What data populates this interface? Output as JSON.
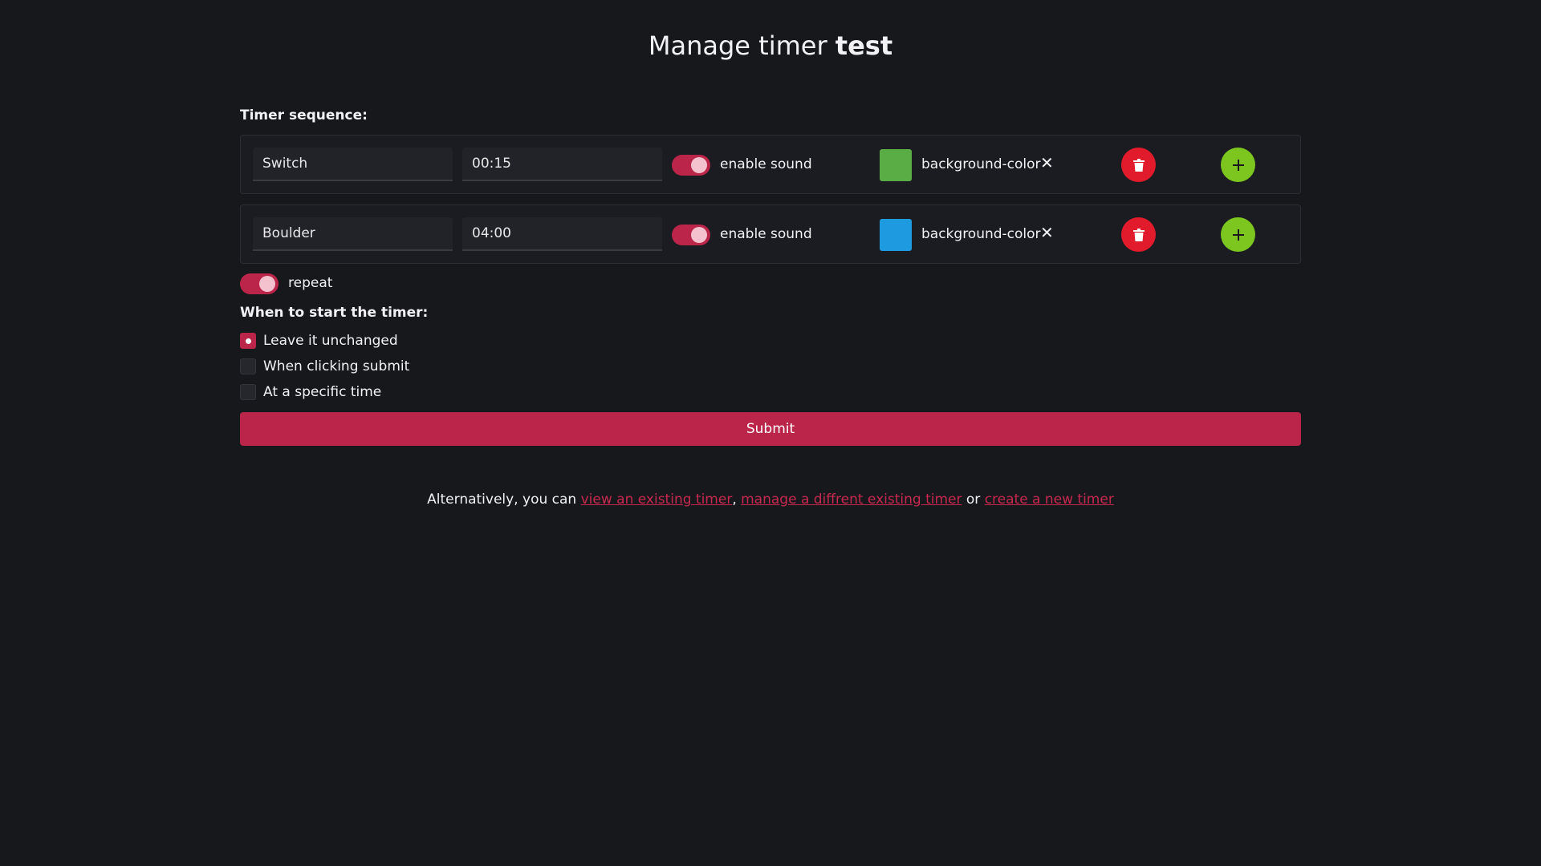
{
  "header": {
    "title_prefix": "Manage timer",
    "timer_name": "test"
  },
  "sequence": {
    "label": "Timer sequence:",
    "rows": [
      {
        "name": "Switch",
        "duration": "00:15",
        "sound_label": "enable sound",
        "sound_enabled": true,
        "color": "#5aac44",
        "color_label": "background-color",
        "clear_symbol": "✕"
      },
      {
        "name": "Boulder",
        "duration": "04:00",
        "sound_label": "enable sound",
        "sound_enabled": true,
        "color": "#1e9be0",
        "color_label": "background-color",
        "clear_symbol": "✕"
      }
    ]
  },
  "repeat": {
    "label": "repeat",
    "enabled": true
  },
  "start": {
    "label": "When to start the timer:",
    "options": [
      {
        "label": "Leave it unchanged",
        "checked": true
      },
      {
        "label": "When clicking submit",
        "checked": false
      },
      {
        "label": "At a specific time",
        "checked": false
      }
    ]
  },
  "submit_label": "Submit",
  "footer": {
    "prefix": "Alternatively, you can",
    "link1": "view an existing timer",
    "sep1": ",",
    "link2": "manage a diffrent existing timer",
    "sep2": "or",
    "link3": "create a new timer"
  },
  "colors": {
    "accent": "#bb2549",
    "delete": "#e21b2c",
    "add": "#7cc61f",
    "background": "#17181c"
  },
  "icons": {
    "delete": "trash-icon",
    "add": "plus-icon",
    "clear": "close-icon"
  }
}
